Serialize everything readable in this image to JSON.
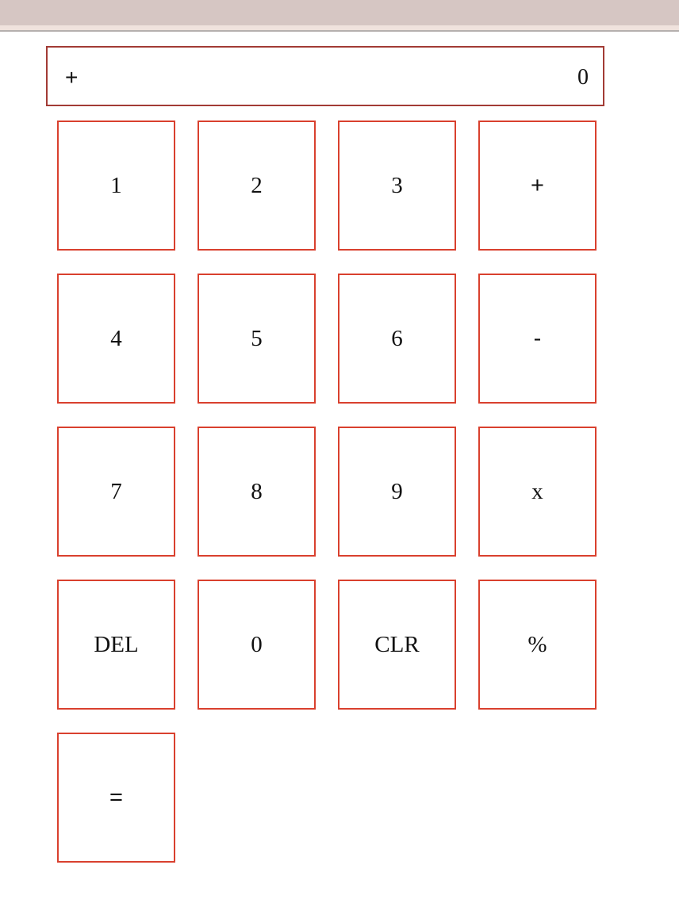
{
  "display": {
    "operator": "+",
    "value": "0"
  },
  "keys": [
    {
      "label": "1"
    },
    {
      "label": "2"
    },
    {
      "label": "3"
    },
    {
      "label": "+"
    },
    {
      "label": "4"
    },
    {
      "label": "5"
    },
    {
      "label": "6"
    },
    {
      "label": "-"
    },
    {
      "label": "7"
    },
    {
      "label": "8"
    },
    {
      "label": "9"
    },
    {
      "label": "x"
    },
    {
      "label": "DEL"
    },
    {
      "label": "0"
    },
    {
      "label": "CLR"
    },
    {
      "label": "%"
    },
    {
      "label": "="
    }
  ],
  "colors": {
    "key_border": "#d9402e",
    "display_border": "#a23b35",
    "top_bar": "#d6c6c3"
  }
}
